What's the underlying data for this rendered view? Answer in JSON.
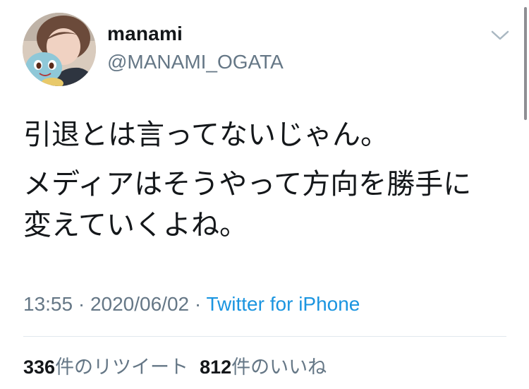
{
  "user": {
    "display_name": "manami",
    "handle": "@MANAMI_OGATA",
    "avatar": "profile-photo"
  },
  "menu": {
    "icon": "chevron-down-icon"
  },
  "tweet": {
    "paragraphs": [
      "引退とは言ってないじゃん。",
      "メディアはそうやって方向を勝手に\n変えていくよね。"
    ]
  },
  "meta": {
    "time": "13:55",
    "separator1": " · ",
    "date": "2020/06/02",
    "separator2": " · ",
    "source": "Twitter for iPhone"
  },
  "stats": {
    "retweets": {
      "count": "336",
      "label": "件のリツイート"
    },
    "likes": {
      "count": "812",
      "label": "件のいいね"
    }
  },
  "colors": {
    "text": "#14171a",
    "secondary": "#657786",
    "link": "#1b95e0",
    "divider": "#e1e8ed"
  }
}
